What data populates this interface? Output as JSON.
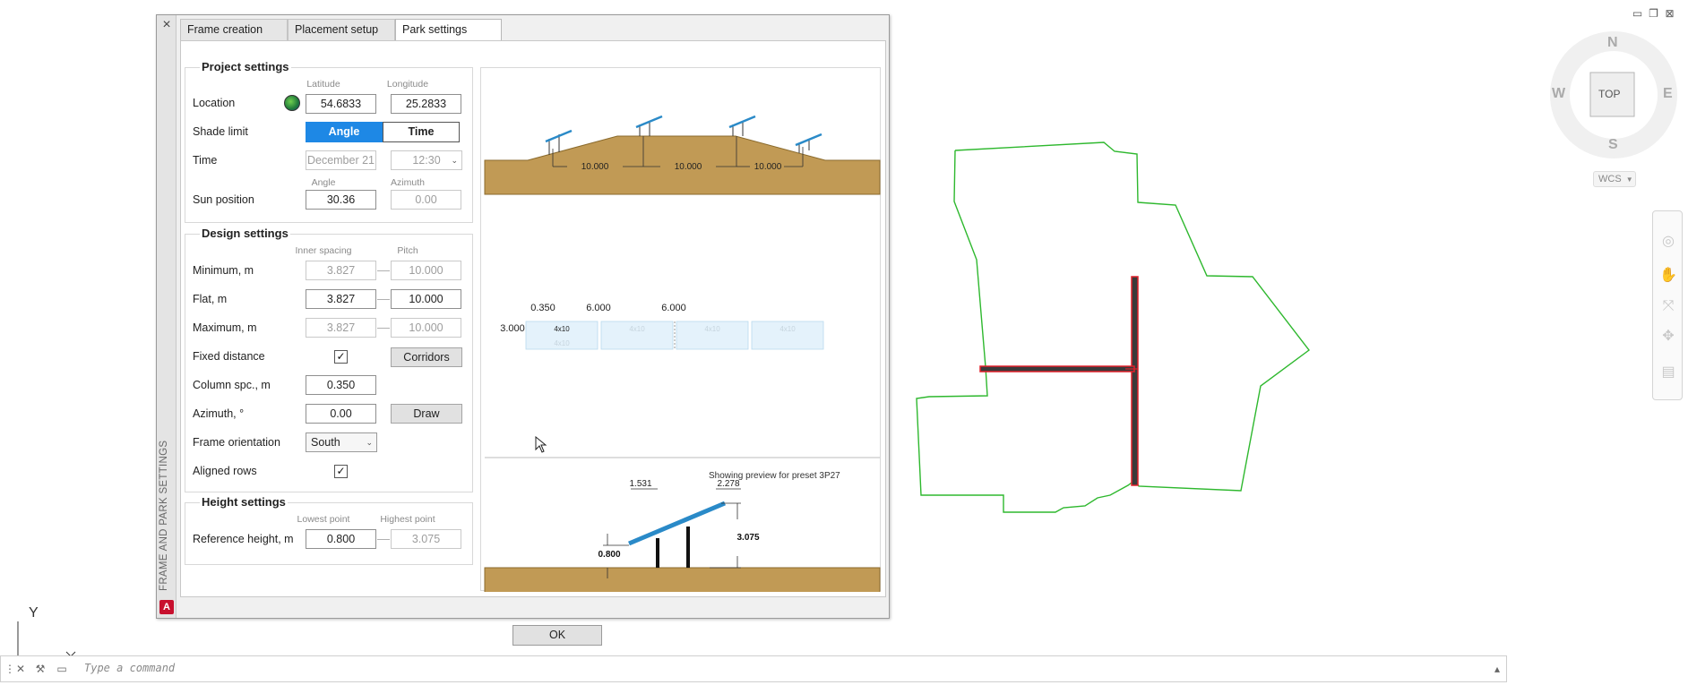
{
  "palette": {
    "vertical_title": "FRAME AND PARK SETTINGS",
    "close_glyph": "×",
    "logo_letter": "A",
    "tabs": [
      {
        "label": "Frame creation"
      },
      {
        "label": "Placement setup"
      },
      {
        "label": "Park settings",
        "active": true
      }
    ],
    "ok_label": "OK"
  },
  "project": {
    "title": "Project settings",
    "hdr_latitude": "Latitude",
    "hdr_longitude": "Longitude",
    "location_label": "Location",
    "latitude": "54.6833",
    "longitude": "25.2833",
    "shade_label": "Shade limit",
    "shade_angle": "Angle",
    "shade_time": "Time",
    "shade_selected": "Angle",
    "time_label": "Time",
    "date": "December 21",
    "time": "12:30",
    "hdr_angle": "Angle",
    "hdr_azimuth": "Azimuth",
    "sun_label": "Sun position",
    "sun_angle": "30.36",
    "sun_azimuth": "0.00"
  },
  "design": {
    "title": "Design settings",
    "hdr_inner": "Inner spacing",
    "hdr_pitch": "Pitch",
    "min_label": "Minimum, m",
    "min_inner": "3.827",
    "min_pitch": "10.000",
    "flat_label": "Flat, m",
    "flat_inner": "3.827",
    "flat_pitch": "10.000",
    "max_label": "Maximum, m",
    "max_inner": "3.827",
    "max_pitch": "10.000",
    "fixed_label": "Fixed distance",
    "fixed_checked": true,
    "corridors_label": "Corridors",
    "column_label": "Column spc., m",
    "column_value": "0.350",
    "azimuth_label": "Azimuth, °",
    "azimuth_value": "0.00",
    "draw_label": "Draw",
    "orientation_label": "Frame orientation",
    "orientation_value": "South",
    "aligned_label": "Aligned rows",
    "aligned_checked": true,
    "check_glyph": "✓"
  },
  "height": {
    "title": "Height settings",
    "hdr_lowest": "Lowest point",
    "hdr_highest": "Highest point",
    "ref_label": "Reference height, m",
    "lowest": "0.800",
    "highest": "3.075"
  },
  "preview": {
    "terrain_dims": [
      "10.000",
      "10.000",
      "10.000"
    ],
    "layout_column_spacing": "0.350",
    "layout_width_1": "6.000",
    "layout_width_2": "6.000",
    "layout_height": "3.000",
    "module_label": "4x10",
    "preset_caption": "Showing preview for preset 3P27",
    "dim_lower_span": "1.531",
    "dim_upper_span": "2.278",
    "dim_low": "0.800",
    "dim_high": "3.075"
  },
  "viewcube": {
    "north": "N",
    "south": "S",
    "east": "E",
    "west": "W",
    "face": "TOP",
    "ucs_menu": "WCS"
  },
  "ucs": {
    "y_label": "Y"
  },
  "cmdline": {
    "placeholder": "Type a command"
  },
  "colors": {
    "accent": "#1e88e5",
    "terrain": "#c19a55",
    "terrain_line": "#8a6a2c",
    "panel": "#2a8ac8",
    "boundary": "#2eb82e",
    "frame_row": "#e0202a"
  }
}
